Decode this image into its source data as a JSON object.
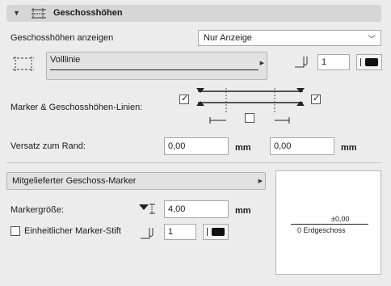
{
  "header": {
    "title": "Geschosshöhen"
  },
  "show_levels": {
    "label": "Geschosshöhen anzeigen",
    "value": "Nur Anzeige"
  },
  "line_type": {
    "value": "Volllinie",
    "pen_value": "1"
  },
  "marker_lines": {
    "label": "Marker & Geschosshöhen-Linien:",
    "left_checked": true,
    "right_checked": true,
    "center_checked": false
  },
  "offset": {
    "label": "Versatz zum Rand:",
    "left_value": "0,00",
    "left_unit": "mm",
    "right_value": "0,00",
    "right_unit": "mm"
  },
  "marker_dropdown": {
    "value": "Mitgelieferter Geschoss-Marker"
  },
  "marker_size": {
    "label": "Markergröße:",
    "value": "4,00",
    "unit": "mm"
  },
  "uniform_pen": {
    "label": "Einheitlicher Marker-Stift",
    "value": "1",
    "checked": false
  },
  "preview": {
    "level_value": "±0,00",
    "level_name": "0 Erdgeschoss"
  },
  "colors": {
    "background": "#ececec",
    "header": "#d6d6d6",
    "pen_swatch": "#111111"
  }
}
